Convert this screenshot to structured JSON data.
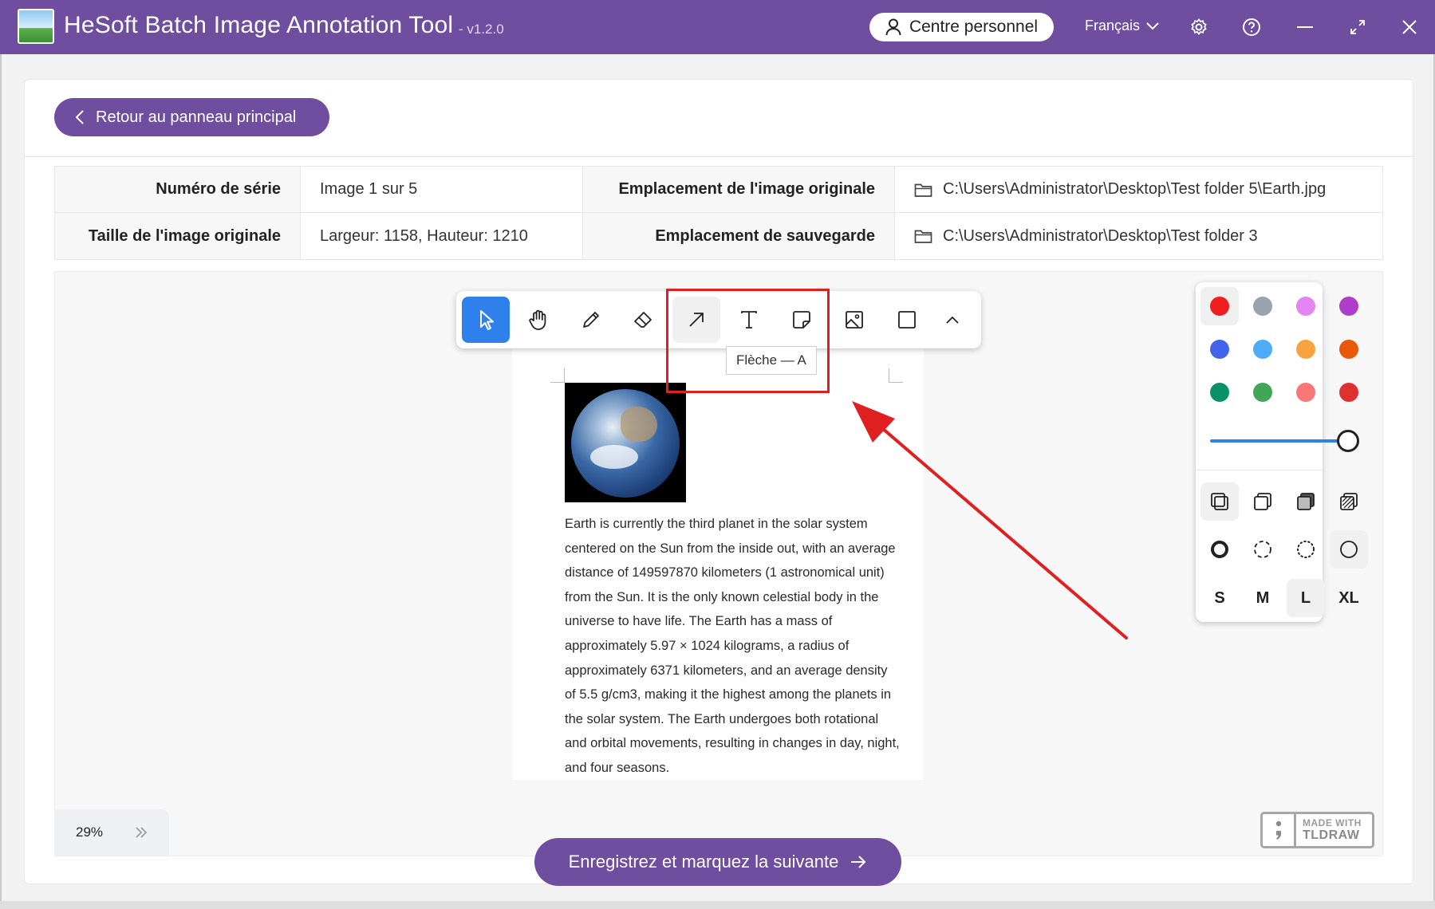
{
  "app": {
    "title": "HeSoft Batch Image Annotation Tool",
    "version": "- v1.2.0",
    "account_label": "Centre personnel",
    "language": "Français"
  },
  "header": {
    "back_label": "Retour au panneau principal"
  },
  "info": {
    "serial_label": "Numéro de série",
    "serial_value": "Image 1 sur 5",
    "size_label": "Taille de l'image originale",
    "size_value": "Largeur: 1158, Hauteur: 1210",
    "orig_loc_label": "Emplacement de l'image originale",
    "orig_loc_value": "C:\\Users\\Administrator\\Desktop\\Test folder 5\\Earth.jpg",
    "save_loc_label": "Emplacement de sauvegarde",
    "save_loc_value": "C:\\Users\\Administrator\\Desktop\\Test folder 3"
  },
  "toolbar": {
    "tools": [
      "select-tool",
      "hand-tool",
      "draw-tool",
      "eraser-tool",
      "arrow-tool",
      "text-tool",
      "note-tool",
      "image-tool",
      "rectangle-tool",
      "more-tools"
    ],
    "active_tool": "select-tool",
    "tooltip": "Flèche — A"
  },
  "document": {
    "paragraph": "Earth is currently the third planet in the solar system centered on the Sun from the inside out, with an average distance of 149597870 kilometers (1 astronomical unit) from the Sun. It is the only known celestial body in the universe to have life. The Earth has a mass of approximately 5.97 × 1024 kilograms, a radius of approximately 6371 kilometers, and an average density of 5.5 g/cm3, making it the highest among the planets in the solar system. The Earth undergoes both rotational and orbital movements, resulting in changes in day, night, and four seasons."
  },
  "style_panel": {
    "colors": [
      "#f01e1e",
      "#9aa4ae",
      "#e486f2",
      "#ae3ec9",
      "#4263eb",
      "#4dabf7",
      "#f7a440",
      "#e8590c",
      "#099268",
      "#40a758",
      "#f87777",
      "#e03131"
    ],
    "selected_color": "#f01e1e",
    "opacity": 1.0,
    "fill_styles": [
      "fill-none",
      "fill-semi",
      "fill-solid",
      "fill-pattern"
    ],
    "dash_styles": [
      "dash-draw",
      "dash-dashed",
      "dash-dotted",
      "dash-solid"
    ],
    "sizes": [
      "S",
      "M",
      "L",
      "XL"
    ],
    "selected_size": "L"
  },
  "zoom": {
    "level": "29%"
  },
  "badge": {
    "line1": "MADE WITH",
    "line2": "TLDRAW"
  },
  "footer": {
    "next_label": "Enregistrez et marquez la suivante"
  },
  "annotation": {
    "arrow_color": "#e02020",
    "highlight_color": "#e02020"
  }
}
